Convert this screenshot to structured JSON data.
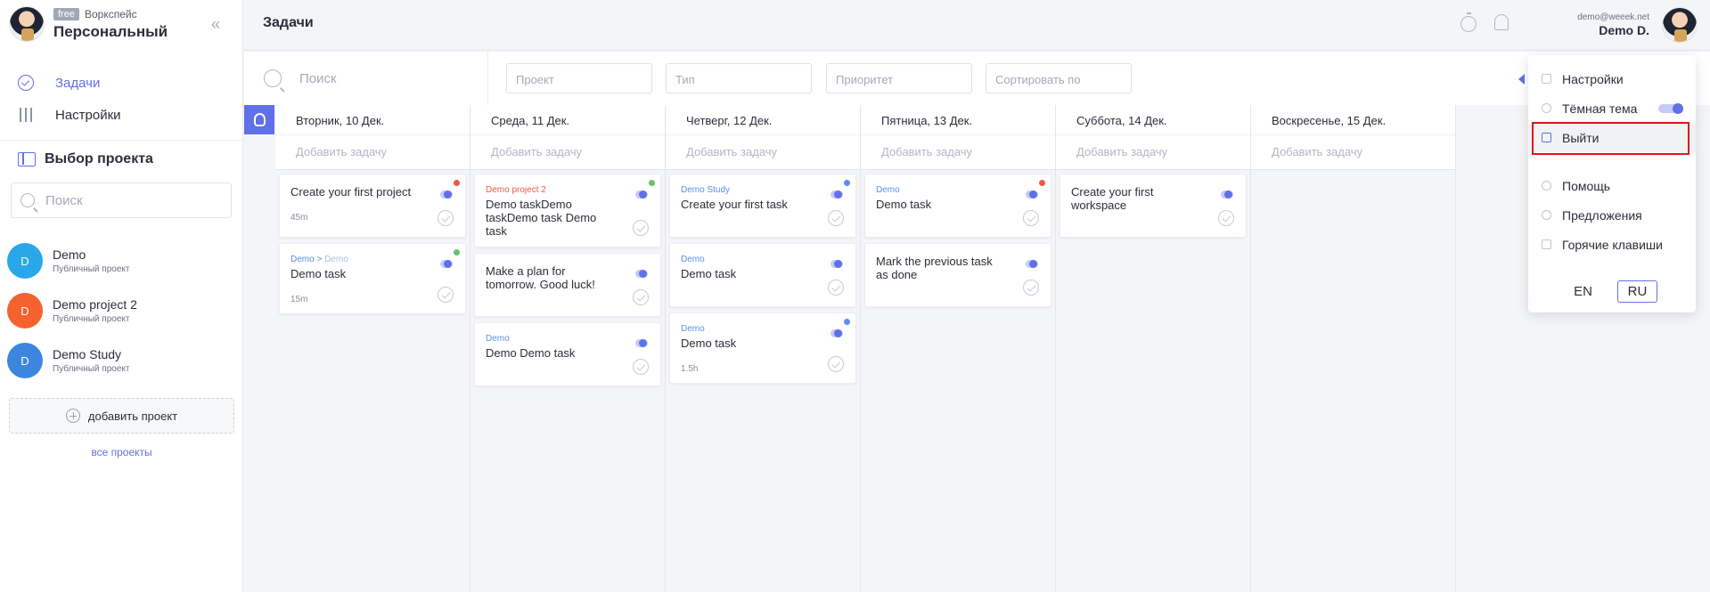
{
  "workspace": {
    "badge": "free",
    "type_label": "Воркспейс",
    "name": "Персональный"
  },
  "nav": [
    {
      "label": "Задачи",
      "icon": "tasks-check-icon",
      "active": true
    },
    {
      "label": "Настройки",
      "icon": "sliders-icon",
      "active": false
    }
  ],
  "projects_section": {
    "title": "Выбор проекта",
    "search_placeholder": "Поиск",
    "items": [
      {
        "initial": "D",
        "name": "Demo",
        "sub": "Публичный проект",
        "color": "#29a7e8"
      },
      {
        "initial": "D",
        "name": "Demo project 2",
        "sub": "Публичный проект",
        "color": "#f5622d"
      },
      {
        "initial": "D",
        "name": "Demo Study",
        "sub": "Публичный проект",
        "color": "#3d86df"
      }
    ],
    "add_label": "добавить проект",
    "all_label": "все проекты"
  },
  "header": {
    "title": "Задачи",
    "user_email": "demo@weeek.net",
    "user_name": "Demo D."
  },
  "filters": {
    "search_placeholder": "Поиск",
    "project_placeholder": "Проект",
    "type_placeholder": "Тип",
    "priority_placeholder": "Приоритет",
    "sort_placeholder": "Сортировать по"
  },
  "columns": [
    {
      "date": "Вторник, 10 Дек.",
      "add": "Добавить задачу",
      "cards": [
        {
          "project": "",
          "title": "Create your first project",
          "duration": "45m",
          "dot": "#ec5a47"
        },
        {
          "project": "Demo > ",
          "project_sub": "Demo",
          "title": "Demo task",
          "duration": "15m",
          "dot": "#6cc06a"
        }
      ]
    },
    {
      "date": "Среда, 11 Дек.",
      "add": "Добавить задачу",
      "cards": [
        {
          "project": "Demo project 2",
          "project_red": true,
          "title": "Demo taskDemo taskDemo task Demo task",
          "duration": "",
          "dot": "#6cc06a"
        },
        {
          "project": "",
          "title": "Make a plan for tomorrow. Good luck!",
          "duration": "",
          "dot": ""
        },
        {
          "project": "Demo",
          "title": "Demo Demo task",
          "duration": "",
          "dot": ""
        }
      ]
    },
    {
      "date": "Четверг, 12 Дек.",
      "add": "Добавить задачу",
      "cards": [
        {
          "project": "Demo Study",
          "title": "Create your first task",
          "duration": "",
          "dot": "#5b8def"
        },
        {
          "project": "Demo",
          "title": "Demo task",
          "duration": "",
          "dot": ""
        },
        {
          "project": "Demo",
          "title": "Demo task",
          "duration": "1.5h",
          "dot": "#5b8def"
        }
      ]
    },
    {
      "date": "Пятница, 13 Дек.",
      "add": "Добавить задачу",
      "cards": [
        {
          "project": "Demo",
          "title": "Demo task",
          "duration": "",
          "dot": "#ec5a47"
        },
        {
          "project": "",
          "title": "Mark the previous task as done",
          "duration": "",
          "dot": ""
        }
      ]
    },
    {
      "date": "Суббота, 14 Дек.",
      "add": "Добавить задачу",
      "cards": [
        {
          "project": "",
          "title": "Create your first workspace",
          "duration": "",
          "dot": ""
        }
      ]
    },
    {
      "date": "Воскресенье, 15 Дек.",
      "add": "Добавить задачу",
      "cards": []
    }
  ],
  "menu": {
    "settings": "Настройки",
    "dark_theme": "Тёмная тема",
    "logout": "Выйти",
    "help": "Помощь",
    "suggestions": "Предложения",
    "hotkeys": "Горячие клавиши",
    "lang_en": "EN",
    "lang_ru": "RU"
  },
  "colors": {
    "accent": "#6070e8",
    "highlight_box": "#e1141c"
  }
}
